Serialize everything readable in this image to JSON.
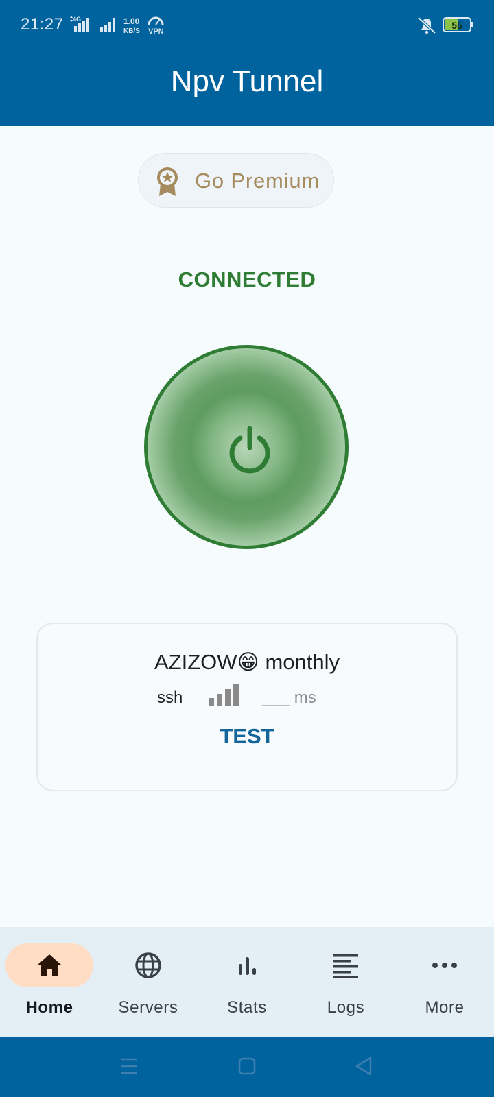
{
  "status_bar": {
    "time": "21:27",
    "network_type": "4G",
    "speed_value": "1.00",
    "speed_unit": "KB/S",
    "vpn_label": "VPN",
    "battery_level": "55"
  },
  "app": {
    "title": "Npv Tunnel"
  },
  "premium": {
    "label": "Go Premium",
    "icon": "award-ribbon-icon"
  },
  "connection": {
    "status": "CONNECTED",
    "status_color": "#2f7d34"
  },
  "server_card": {
    "name": "AZIZOW😁 monthly",
    "protocol": "ssh",
    "ping": "___ ms",
    "test_label": "TEST"
  },
  "nav": {
    "items": [
      {
        "label": "Home",
        "icon": "home-icon",
        "active": true
      },
      {
        "label": "Servers",
        "icon": "globe-icon",
        "active": false
      },
      {
        "label": "Stats",
        "icon": "bar-chart-icon",
        "active": false
      },
      {
        "label": "Logs",
        "icon": "list-icon",
        "active": false
      },
      {
        "label": "More",
        "icon": "more-horizontal-icon",
        "active": false
      }
    ]
  },
  "colors": {
    "primary": "#00639d",
    "connected_green": "#2f7d34",
    "premium_gold": "#a68b5f",
    "active_pill": "#ffdcc4"
  }
}
